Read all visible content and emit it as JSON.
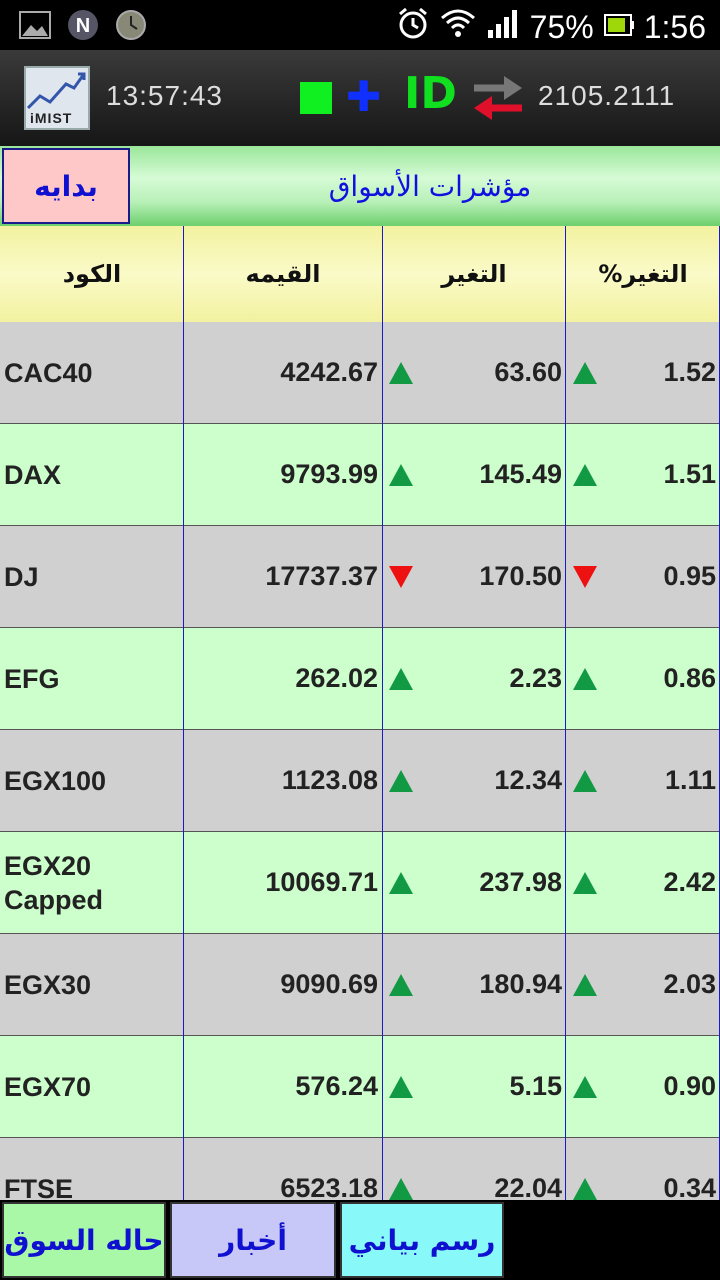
{
  "status_bar": {
    "battery_pct": "75%",
    "clock": "1:56"
  },
  "toolbar": {
    "logo_text": "iMIST",
    "time": "13:57:43",
    "index_value": "2105.2111",
    "id_label": "ID",
    "plus_label": "✚"
  },
  "title_bar": {
    "start_button": "بدايه",
    "title": "مؤشرات الأسواق"
  },
  "table": {
    "headers": {
      "code": "الكود",
      "value": "القيمه",
      "change": "التغير",
      "pct_change": "%التغير"
    },
    "rows": [
      {
        "code": "CAC40",
        "value": "4242.67",
        "change": "63.60",
        "pct": "1.52",
        "direction": "up"
      },
      {
        "code": "DAX",
        "value": "9793.99",
        "change": "145.49",
        "pct": "1.51",
        "direction": "up"
      },
      {
        "code": "DJ",
        "value": "17737.37",
        "change": "170.50",
        "pct": "0.95",
        "direction": "down"
      },
      {
        "code": "EFG",
        "value": "262.02",
        "change": "2.23",
        "pct": "0.86",
        "direction": "up"
      },
      {
        "code": "EGX100",
        "value": "1123.08",
        "change": "12.34",
        "pct": "1.11",
        "direction": "up"
      },
      {
        "code": "EGX20 Capped",
        "value": "10069.71",
        "change": "237.98",
        "pct": "2.42",
        "direction": "up"
      },
      {
        "code": "EGX30",
        "value": "9090.69",
        "change": "180.94",
        "pct": "2.03",
        "direction": "up"
      },
      {
        "code": "EGX70",
        "value": "576.24",
        "change": "5.15",
        "pct": "0.90",
        "direction": "up"
      },
      {
        "code": "FTSE",
        "value": "6523.18",
        "change": "22.04",
        "pct": "0.34",
        "direction": "up"
      }
    ]
  },
  "bottom_bar": {
    "market_status": "حاله السوق",
    "news": "أخبار",
    "chart": "رسم بياني"
  },
  "colors": {
    "up": "#119944",
    "down": "#ee1111",
    "row_gray": "#d0d0d0",
    "row_green": "#ccffcc",
    "accent_blue": "#1010d0"
  }
}
